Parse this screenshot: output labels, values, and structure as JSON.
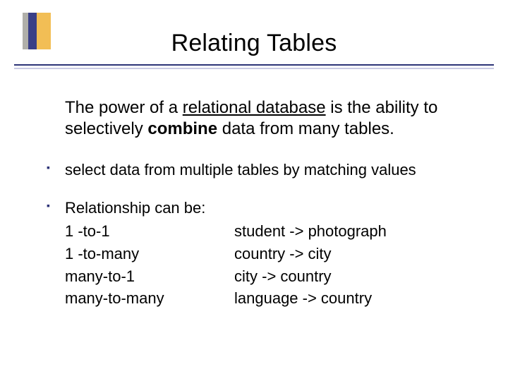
{
  "title": "Relating Tables",
  "intro": {
    "pre": "The power of a ",
    "underline": "relational database",
    "mid": " is the ability to selectively ",
    "bold": "combine",
    "post": " data from many tables."
  },
  "bullets": {
    "b1": "select data from multiple tables by matching values",
    "b2_lead": "Relationship can be:",
    "relations": {
      "r1": {
        "left": "1 -to-1",
        "right": "student -> photograph"
      },
      "r2": {
        "left": "1 -to-many",
        "right": "country -> city"
      },
      "r3": {
        "left": "many-to-1",
        "right": "city -> country"
      },
      "r4": {
        "left": "many-to-many",
        "right": "language -> country"
      }
    }
  }
}
